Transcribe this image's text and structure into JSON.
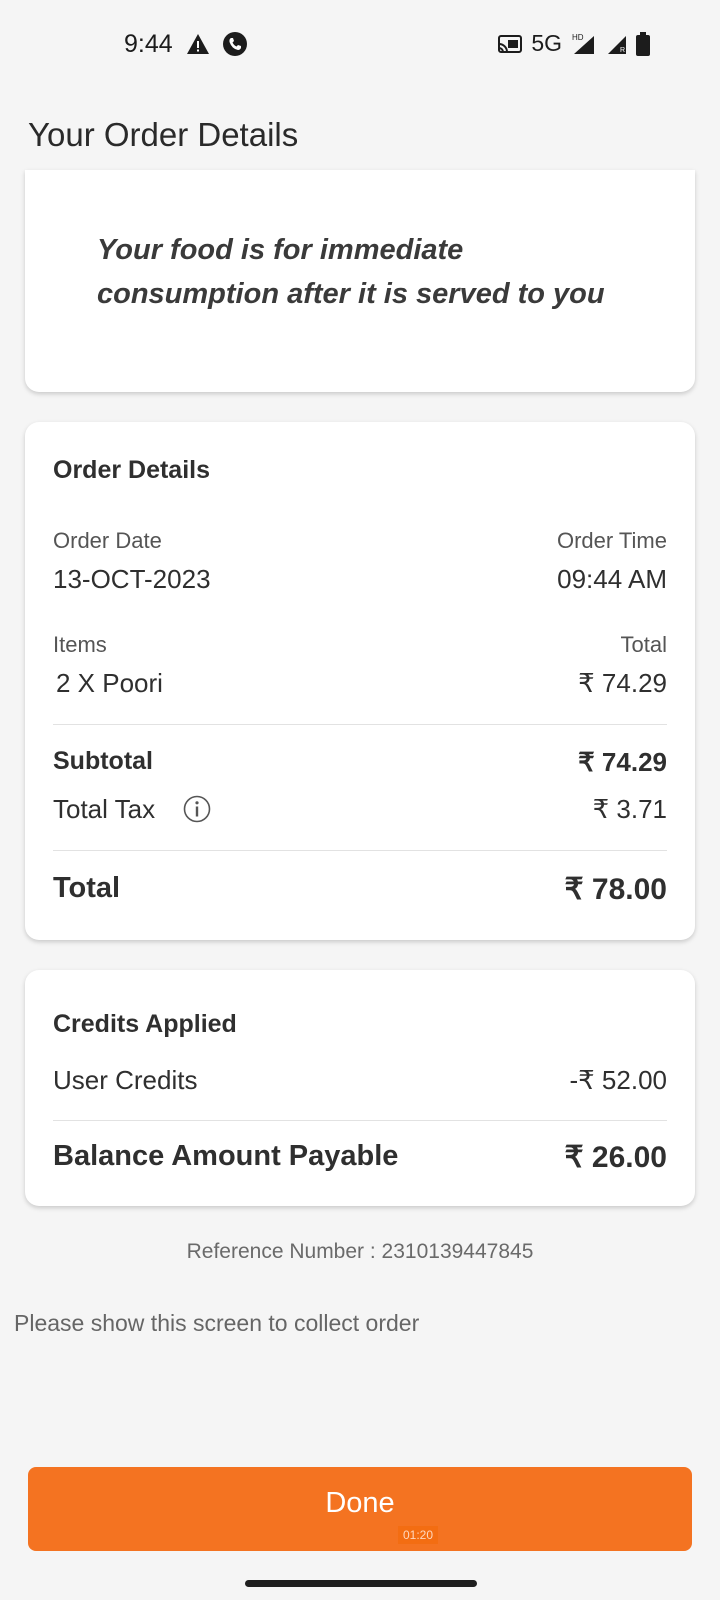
{
  "status_bar": {
    "time": "9:44",
    "network": "5G",
    "icons": [
      "warning-icon",
      "phone-icon",
      "cast-icon",
      "signal-hd-icon",
      "signal-r-icon",
      "battery-icon"
    ]
  },
  "page": {
    "title": "Your Order Details"
  },
  "notice": {
    "text": "Your food is for immediate consumption after it is served to you"
  },
  "order_details": {
    "heading": "Order Details",
    "order_date_label": "Order Date",
    "order_date": "13-OCT-2023",
    "order_time_label": "Order Time",
    "order_time": "09:44 AM",
    "items_label": "Items",
    "total_label": "Total",
    "items": [
      {
        "name": "2 X Poori",
        "total": "₹ 74.29"
      }
    ],
    "subtotal_label": "Subtotal",
    "subtotal": "₹ 74.29",
    "tax_label": "Total Tax",
    "tax": "₹ 3.71",
    "grand_total_label": "Total",
    "grand_total": "₹ 78.00"
  },
  "credits": {
    "heading": "Credits Applied",
    "user_credits_label": "User Credits",
    "user_credits": "-₹ 52.00",
    "balance_label": "Balance Amount Payable",
    "balance": "₹ 26.00"
  },
  "footer": {
    "reference": "Reference Number : 2310139447845",
    "collect_note": "Please show this screen to collect order"
  },
  "done_button": {
    "label": "Done",
    "timer": "01:20"
  },
  "colors": {
    "accent": "#f47321",
    "background": "#f5f5f5"
  }
}
